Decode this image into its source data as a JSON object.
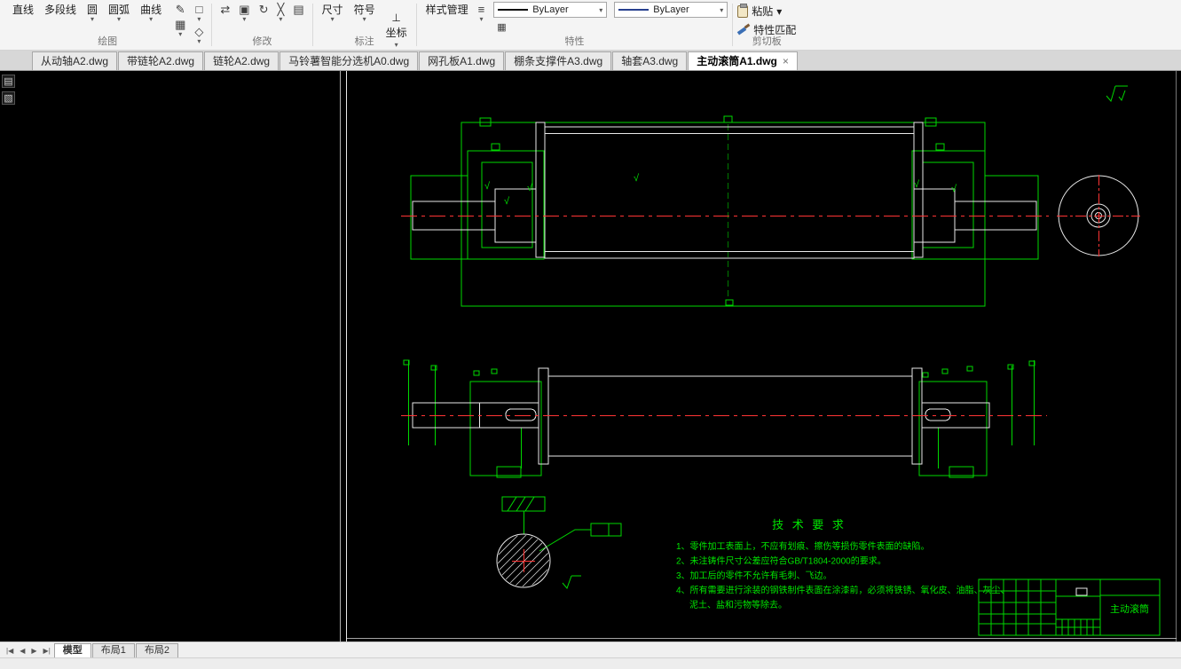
{
  "ribbon": {
    "draw": {
      "label": "绘图",
      "tools": [
        "直线",
        "多段线",
        "圆",
        "圆弧",
        "曲线"
      ]
    },
    "modify": {
      "label": "修改"
    },
    "annotate": {
      "label": "标注",
      "tools": [
        "尺寸",
        "符号",
        "坐标"
      ]
    },
    "properties": {
      "label": "特性",
      "style_manager": "样式管理",
      "linetype": "ByLayer",
      "color": "ByLayer"
    },
    "clipboard": {
      "label": "剪切板",
      "paste": "粘贴",
      "match": "特性匹配"
    }
  },
  "file_tabs": [
    {
      "label": "从动轴A2.dwg",
      "active": false
    },
    {
      "label": "带链轮A2.dwg",
      "active": false
    },
    {
      "label": "链轮A2.dwg",
      "active": false
    },
    {
      "label": "马铃薯智能分选机A0.dwg",
      "active": false
    },
    {
      "label": "网孔板A1.dwg",
      "active": false
    },
    {
      "label": "棚条支撑件A3.dwg",
      "active": false
    },
    {
      "label": "轴套A3.dwg",
      "active": false
    },
    {
      "label": "主动滚筒A1.dwg",
      "active": true
    }
  ],
  "drawing": {
    "tech_title": "技 术 要 求",
    "tech_lines": [
      "1、零件加工表面上，不应有划痕、擦伤等损伤零件表面的缺陷。",
      "2、未注铸件尺寸公差应符合GB/T1804-2000的要求。",
      "3、加工后的零件不允许有毛刺、飞边。",
      "4、所有需要进行涂装的钢铁制件表面在涂漆前，必须将铁锈、氧化皮、油脂、灰尘、",
      "泥土、盐和污物等除去。"
    ],
    "title_block": {
      "part_name": "主动滚筒"
    }
  },
  "layout_tabs": [
    {
      "label": "模型",
      "active": true
    },
    {
      "label": "布局1",
      "active": false
    },
    {
      "label": "布局2",
      "active": false
    }
  ],
  "nav": {
    "first": "|◀",
    "prev": "◀",
    "next": "▶",
    "last": "▶|"
  },
  "icons": {
    "caret": "▾",
    "pencil": "✎",
    "hatch": "▦",
    "rectangle": "□",
    "polygon": "◇",
    "move": "⇄",
    "copy": "▣",
    "rotate": "↻",
    "trim": "╳",
    "array": "▤",
    "lineweight": "≡",
    "coord": "⊥",
    "roughness": "√",
    "close": "×",
    "note": "▤",
    "book": "▧"
  },
  "colors": {
    "cad_green": "#00d800",
    "cad_red": "#ff3434",
    "cad_white": "#e9e9e9",
    "canvas_bg": "#000000",
    "color_swatch_blue": "#27408f"
  }
}
